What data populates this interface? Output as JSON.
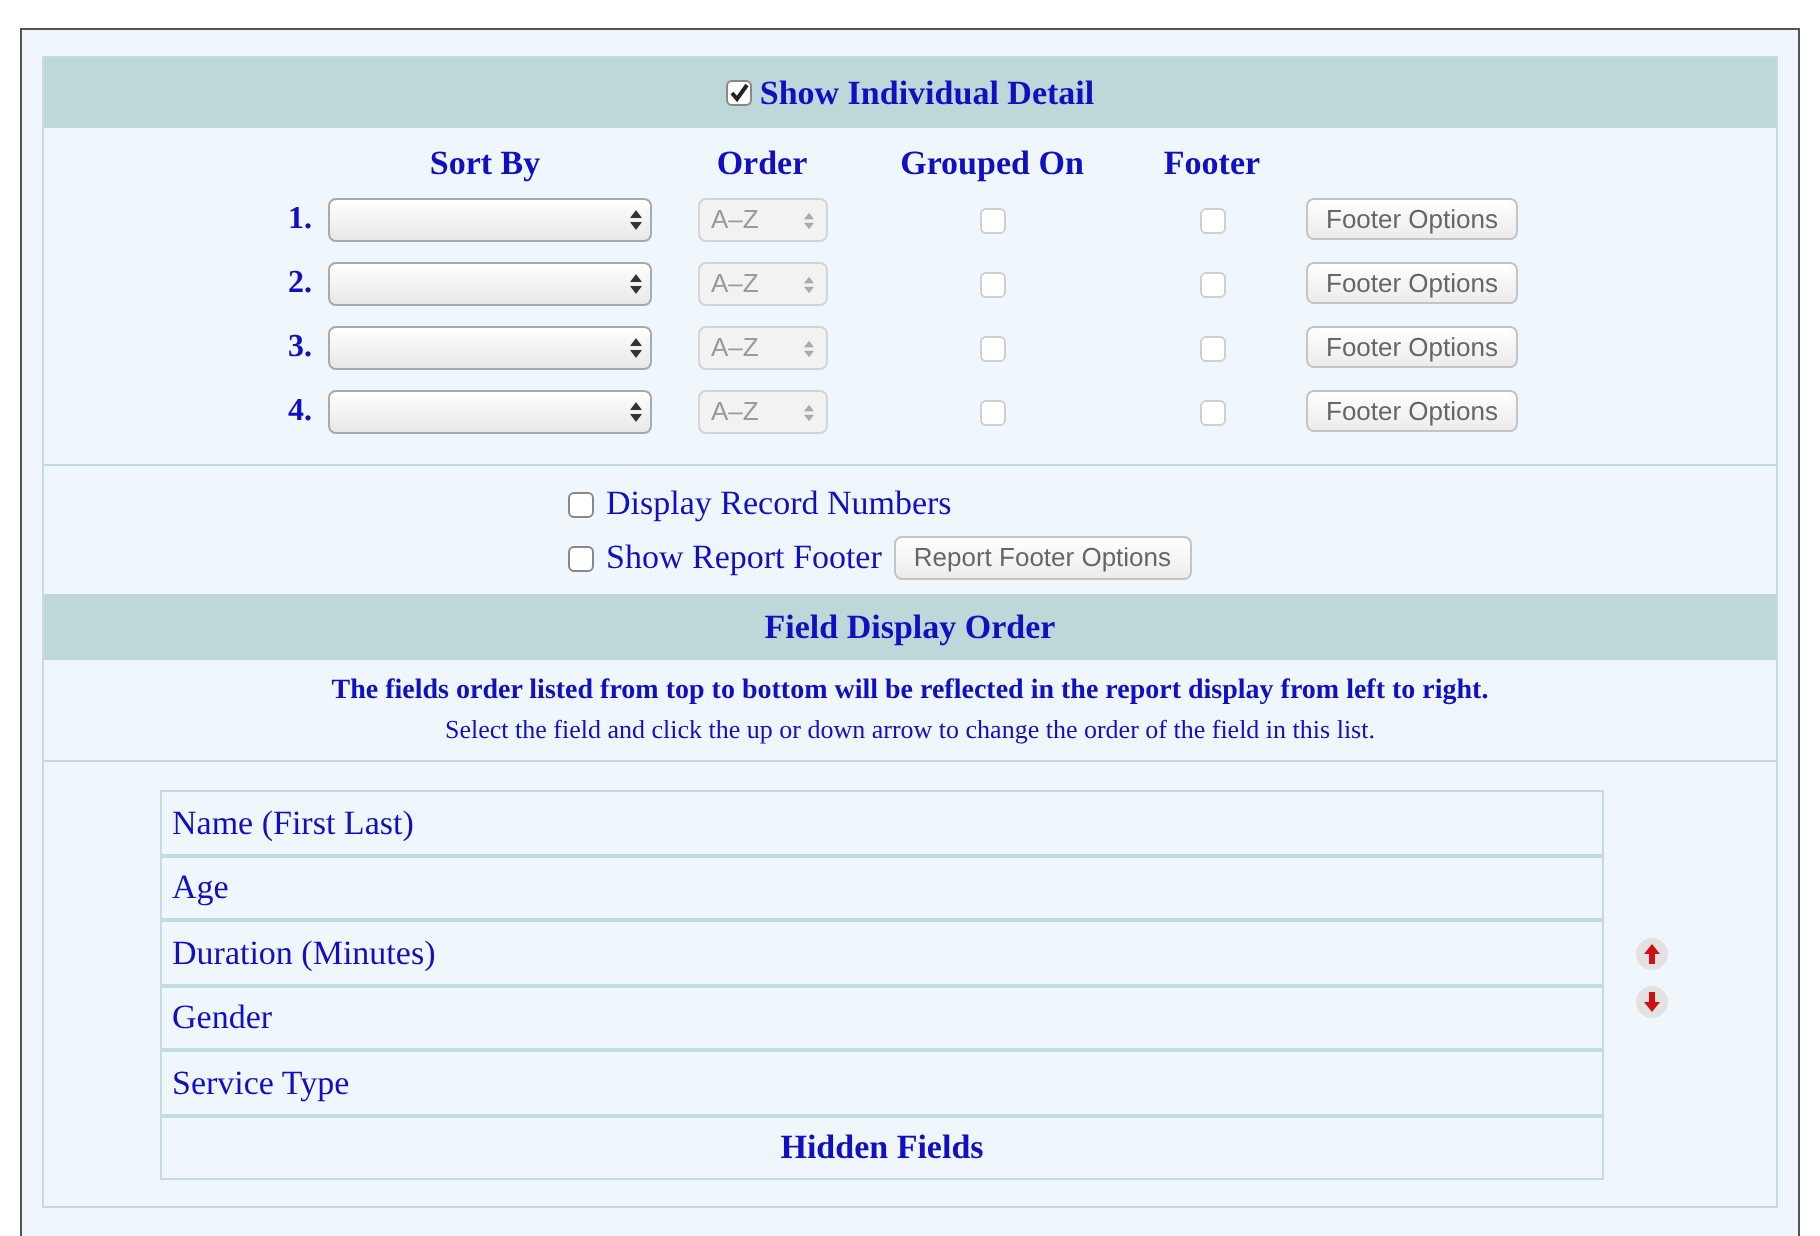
{
  "detail": {
    "label": "Show Individual Detail",
    "checked": true
  },
  "sort": {
    "columns": [
      "Sort By",
      "Order",
      "Grouped On",
      "Footer"
    ],
    "rows": [
      {
        "number": "1.",
        "order": "A–Z",
        "grouped_on": false,
        "footer": false,
        "button": "Footer Options"
      },
      {
        "number": "2.",
        "order": "A–Z",
        "grouped_on": false,
        "footer": false,
        "button": "Footer Options"
      },
      {
        "number": "3.",
        "order": "A–Z",
        "grouped_on": false,
        "footer": false,
        "button": "Footer Options"
      },
      {
        "number": "4.",
        "order": "A–Z",
        "grouped_on": false,
        "footer": false,
        "button": "Footer Options"
      }
    ]
  },
  "options": [
    {
      "label": "Display Record Numbers",
      "checked": false
    },
    {
      "label": "Show Report Footer",
      "checked": false,
      "button": "Report Footer Options"
    }
  ],
  "field_order": {
    "title": "Field Display Order",
    "note": "The fields order listed from top to bottom will be reflected in the report display from left to right.",
    "hint": "Select the field and click the up or down arrow to change the order of the field in this list.",
    "fields": [
      "Name (First Last)",
      "Age",
      "Duration (Minutes)",
      "Gender",
      "Service Type"
    ],
    "hidden_label": "Hidden Fields"
  }
}
